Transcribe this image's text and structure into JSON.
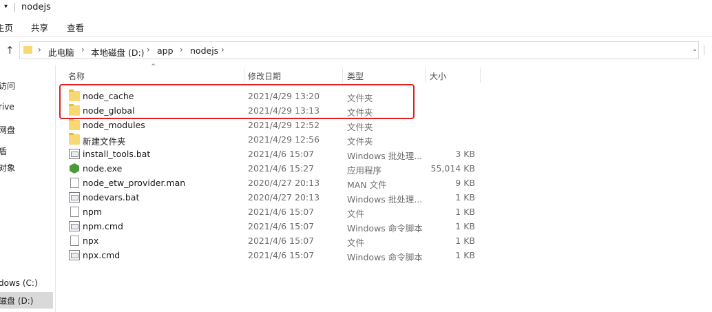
{
  "window": {
    "title": "nodejs"
  },
  "ribbon": {
    "tabs": [
      "主页",
      "共享",
      "查看"
    ],
    "tab0_visible": "主页"
  },
  "address": {
    "crumbs": [
      "此电脑",
      "本地磁盘 (D:)",
      "app",
      "nodejs"
    ]
  },
  "nav": {
    "items": [
      "访问",
      "Drive",
      "网盘",
      "盾",
      "对象",
      "Windows (C:)",
      "本地磁盘 (D:)"
    ],
    "visible": [
      "访问",
      "rive",
      "网盘",
      "盾",
      "对象",
      "dows (C:)",
      "磁盘 (D:)"
    ]
  },
  "columns": {
    "name": "名称",
    "date": "修改日期",
    "type": "类型",
    "size": "大小"
  },
  "files": [
    {
      "name": "node_cache",
      "date": "2021/4/29 13:20",
      "type": "文件夹",
      "size": "",
      "icon": "folder-icon"
    },
    {
      "name": "node_global",
      "date": "2021/4/29 13:13",
      "type": "文件夹",
      "size": "",
      "icon": "folder-icon"
    },
    {
      "name": "node_modules",
      "date": "2021/4/29 12:52",
      "type": "文件夹",
      "size": "",
      "icon": "folder-icon"
    },
    {
      "name": "新建文件夹",
      "date": "2021/4/29 12:56",
      "type": "文件夹",
      "size": "",
      "icon": "folder-icon"
    },
    {
      "name": "install_tools.bat",
      "date": "2021/4/6 15:07",
      "type": "Windows 批处理...",
      "size": "3 KB",
      "icon": "batch-file-icon"
    },
    {
      "name": "node.exe",
      "date": "2021/4/6 15:27",
      "type": "应用程序",
      "size": "55,014 KB",
      "icon": "node-exe-icon"
    },
    {
      "name": "node_etw_provider.man",
      "date": "2020/4/27 20:13",
      "type": "MAN 文件",
      "size": "9 KB",
      "icon": "file-icon"
    },
    {
      "name": "nodevars.bat",
      "date": "2020/4/27 20:13",
      "type": "Windows 批处理...",
      "size": "1 KB",
      "icon": "batch-file-icon"
    },
    {
      "name": "npm",
      "date": "2021/4/6 15:07",
      "type": "文件",
      "size": "1 KB",
      "icon": "file-icon"
    },
    {
      "name": "npm.cmd",
      "date": "2021/4/6 15:07",
      "type": "Windows 命令脚本",
      "size": "1 KB",
      "icon": "batch-file-icon"
    },
    {
      "name": "npx",
      "date": "2021/4/6 15:07",
      "type": "文件",
      "size": "1 KB",
      "icon": "file-icon"
    },
    {
      "name": "npx.cmd",
      "date": "2021/4/6 15:07",
      "type": "Windows 命令脚本",
      "size": "1 KB",
      "icon": "batch-file-icon"
    }
  ],
  "colors": {
    "highlight": "#e02020",
    "folder": "#f8d775",
    "node": "#4a9a3a"
  }
}
